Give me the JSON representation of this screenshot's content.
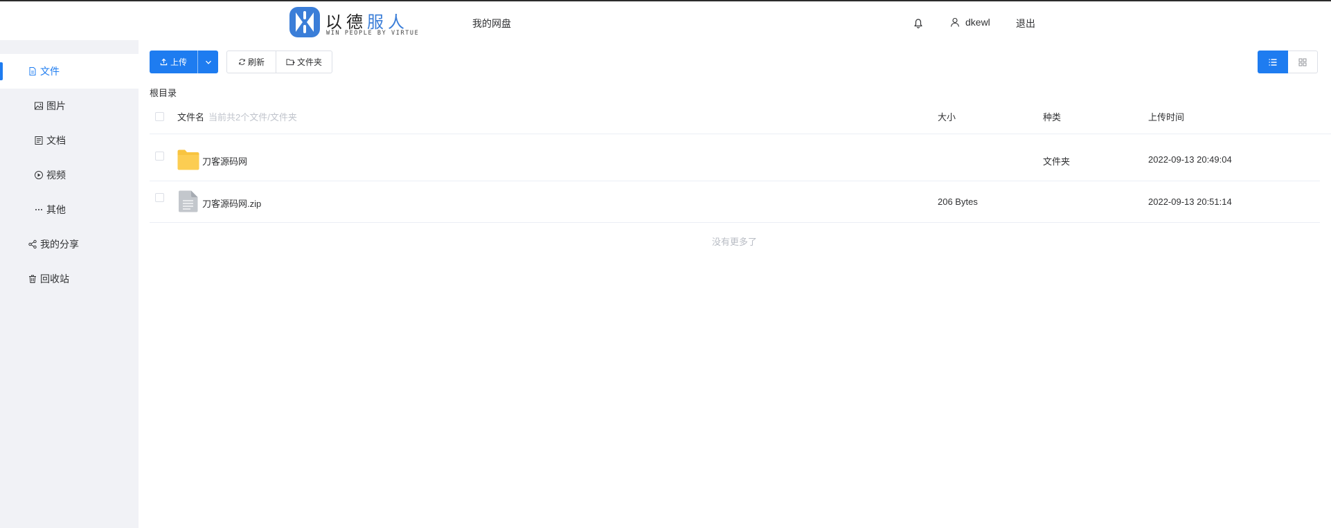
{
  "header": {
    "logo_cn_main": "以德",
    "logo_cn_accent": "服人",
    "logo_en": "WIN PEOPLE BY VIRTUE",
    "nav_title": "我的网盘",
    "username": "dkewl",
    "logout": "退出",
    "colors": {
      "brand": "#3b7ed8",
      "primary": "#1e7cf0"
    }
  },
  "sidebar": {
    "items": [
      {
        "label": "文件",
        "icon": "file-icon",
        "active": true
      },
      {
        "label": "图片",
        "icon": "image-icon"
      },
      {
        "label": "文档",
        "icon": "document-icon"
      },
      {
        "label": "视频",
        "icon": "video-icon"
      },
      {
        "label": "其他",
        "icon": "more-icon"
      },
      {
        "label": "我的分享",
        "icon": "share-icon"
      },
      {
        "label": "回收站",
        "icon": "trash-icon"
      }
    ]
  },
  "toolbar": {
    "upload": "上传",
    "refresh": "刷新",
    "new_folder": "文件夹"
  },
  "breadcrumb": "根目录",
  "table": {
    "headers": {
      "name": "文件名",
      "count_hint": "当前共2个文件/文件夹",
      "size": "大小",
      "type": "种类",
      "time": "上传时间"
    },
    "rows": [
      {
        "name": "刀客源码网",
        "size": "",
        "type": "文件夹",
        "time": "2022-09-13 20:49:04",
        "icon": "folder-icon"
      },
      {
        "name": "刀客源码网.zip",
        "size": "206 Bytes",
        "type": "",
        "time": "2022-09-13 20:51:14",
        "icon": "file-doc-icon"
      }
    ],
    "footer": "没有更多了"
  }
}
